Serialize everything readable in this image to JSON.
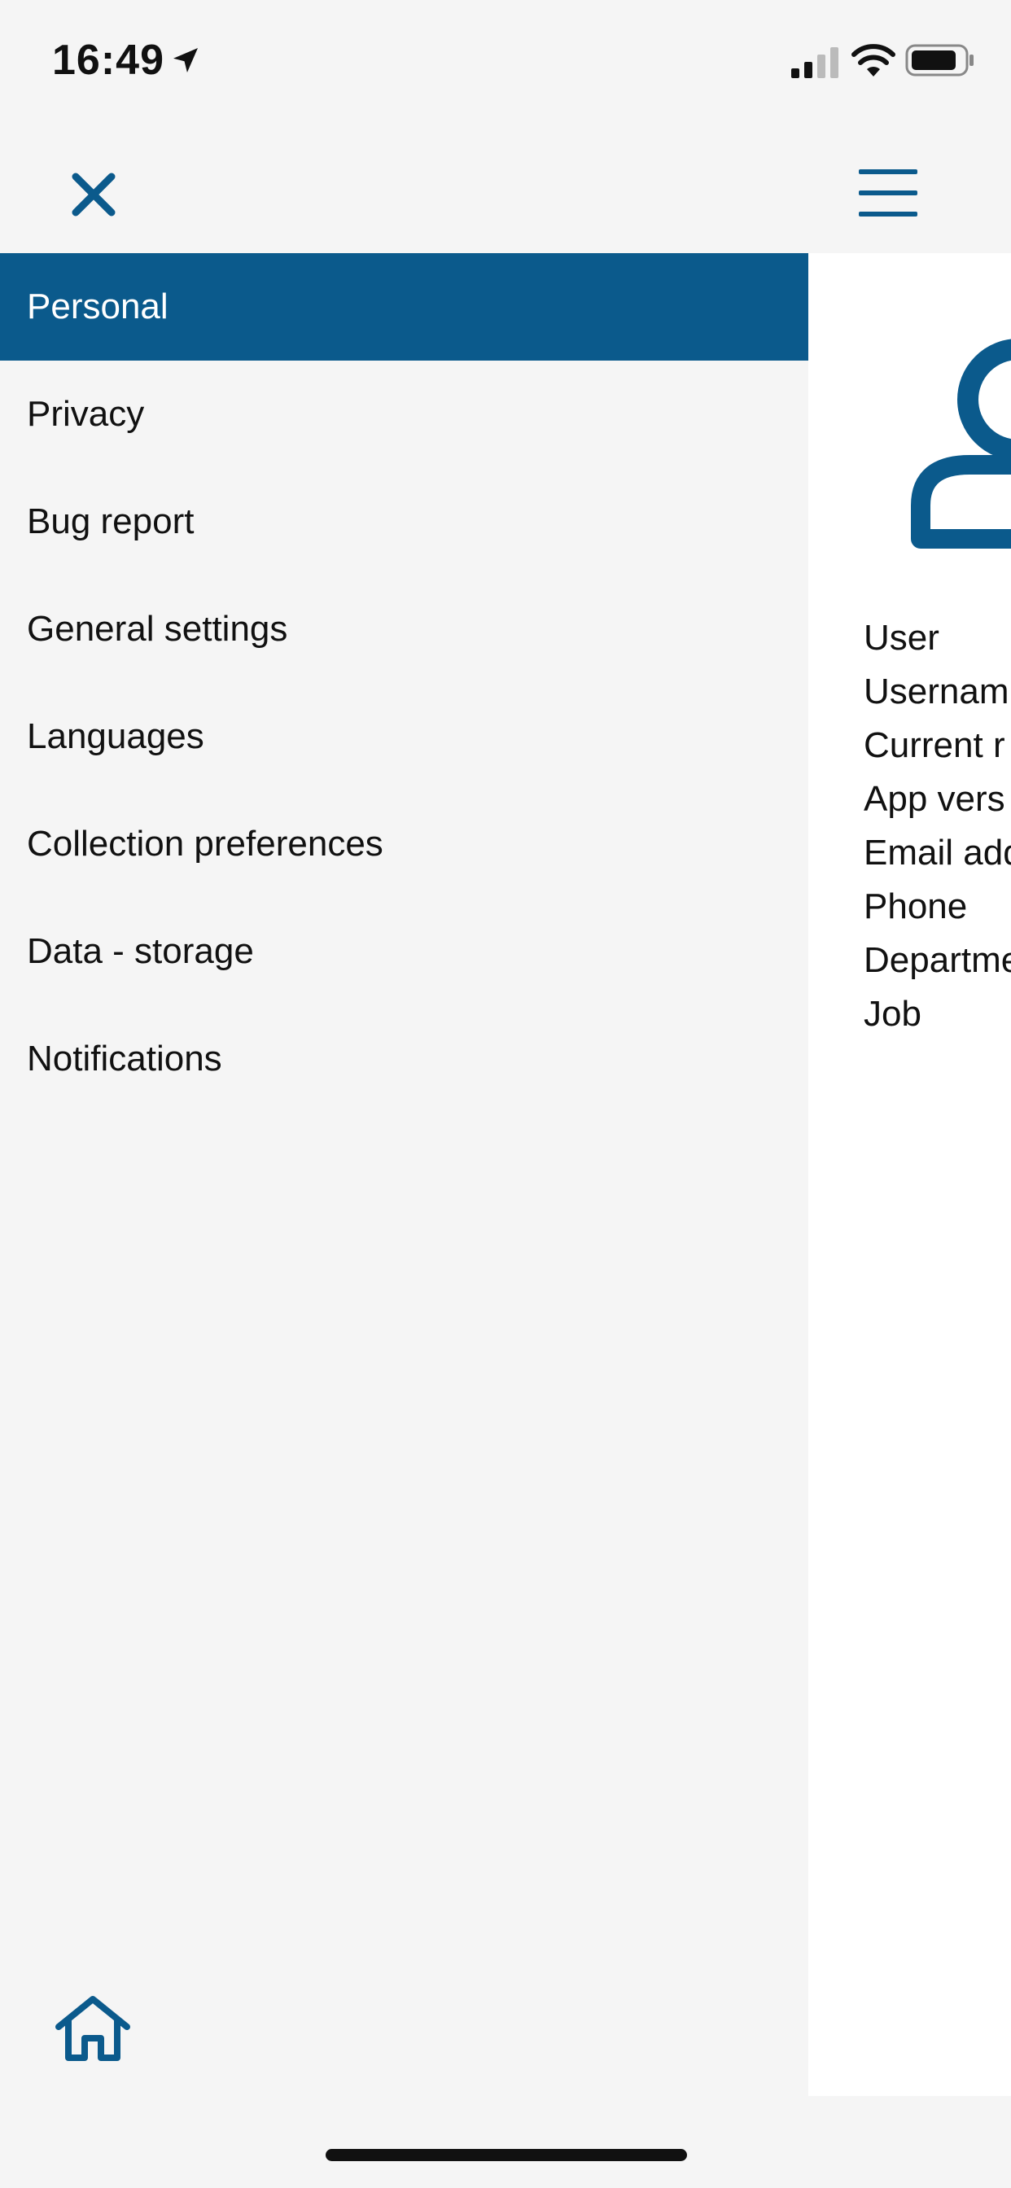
{
  "status_bar": {
    "time": "16:49",
    "icons": [
      "location-arrow-icon",
      "cellular-signal-icon",
      "wifi-icon",
      "battery-icon"
    ]
  },
  "top_bar": {
    "close_icon": "close-icon",
    "menu_icon": "hamburger-menu-icon"
  },
  "drawer": {
    "items": [
      {
        "label": "Personal",
        "active": true
      },
      {
        "label": "Privacy",
        "active": false
      },
      {
        "label": "Bug report",
        "active": false
      },
      {
        "label": "General settings",
        "active": false
      },
      {
        "label": "Languages",
        "active": false
      },
      {
        "label": "Collection preferences",
        "active": false
      },
      {
        "label": "Data - storage",
        "active": false
      },
      {
        "label": "Notifications",
        "active": false
      }
    ],
    "footer_icon": "home-icon"
  },
  "content": {
    "avatar_icon": "user-avatar-icon",
    "info_labels": [
      "User",
      "Usernam",
      "Current r",
      "App vers",
      "Email add",
      "Phone",
      "Departme",
      "Job"
    ]
  },
  "colors": {
    "accent": "#0b5a8c",
    "background": "#f5f5f5",
    "content_background": "#ffffff",
    "text": "#111111"
  }
}
